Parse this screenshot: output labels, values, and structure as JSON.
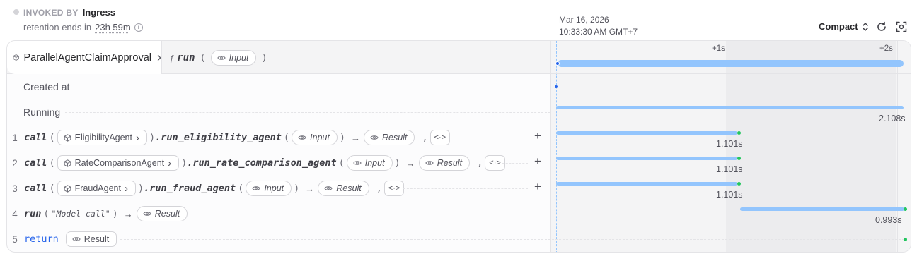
{
  "header": {
    "invoked_by_label": "INVOKED BY",
    "invoked_by_value": "Ingress",
    "retention_prefix": "retention ends in",
    "retention_value": "23h 59m",
    "date": "Mar 16, 2026",
    "time": "10:33:30 AM GMT+7",
    "view_mode": "Compact",
    "icons": [
      "info-icon",
      "refresh-icon",
      "focus-icon",
      "chevron-updown-icon"
    ]
  },
  "invocation": {
    "service": "ParallelAgentClaimApproval",
    "fn_symbol": "ƒ",
    "handler": "run",
    "input_label": "Input"
  },
  "timeline": {
    "ticks": [
      "+1s",
      "+2s"
    ],
    "created_label": "Created at",
    "running_label": "Running",
    "running_duration": "2.108s"
  },
  "steps": [
    {
      "num": "1",
      "kw": "call",
      "target": "EligibilityAgent",
      "method": ".run_eligibility_agent",
      "input": "Input",
      "result": "Result",
      "duration": "1.101s"
    },
    {
      "num": "2",
      "kw": "call",
      "target": "RateComparisonAgent",
      "method": ".run_rate_comparison_agent",
      "input": "Input",
      "result": "Result",
      "duration": "1.101s"
    },
    {
      "num": "3",
      "kw": "call",
      "target": "FraudAgent",
      "method": ".run_fraud_agent",
      "input": "Input",
      "result": "Result",
      "duration": "1.101s"
    },
    {
      "num": "4",
      "kw": "run",
      "arg": "\"Model call\"",
      "result": "Result",
      "duration": "0.993s"
    },
    {
      "num": "5",
      "kw": "return",
      "result": "Result"
    }
  ],
  "symbols": {
    "open": "(",
    "close": ")",
    "arrow": "→",
    "comma": ",",
    "plus": "+",
    "code": "<·>",
    "chevron": "›"
  },
  "colors": {
    "bar": "#93c5fd",
    "complete": "#22c55e",
    "start": "#2563eb"
  }
}
